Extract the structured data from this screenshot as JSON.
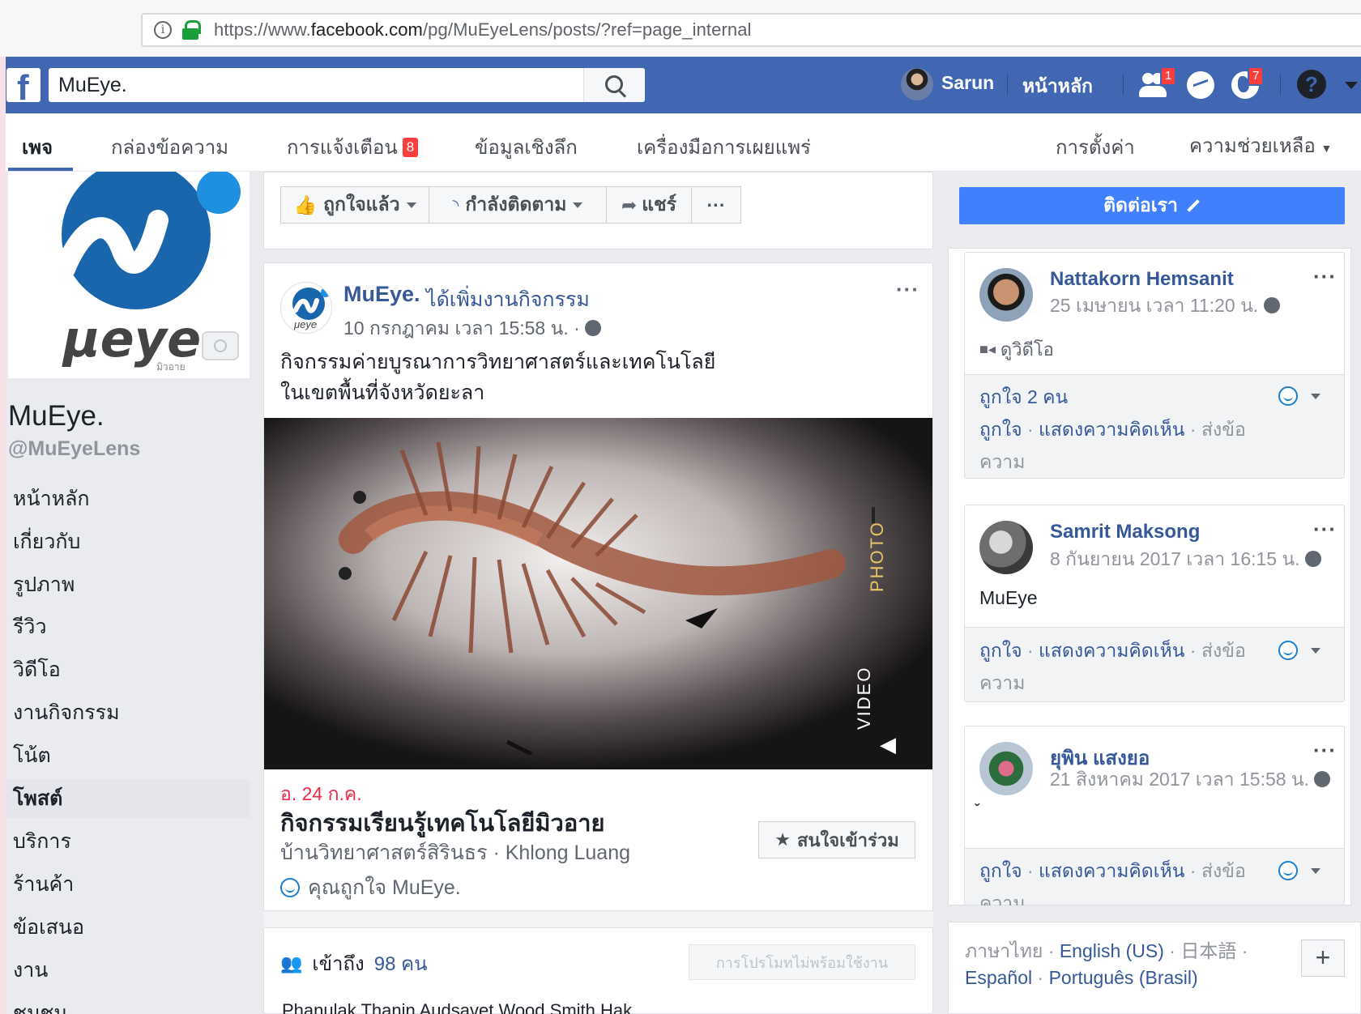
{
  "browser": {
    "url_prefix": "https://www.",
    "url_domain": "facebook.com",
    "url_path": "/pg/MuEyeLens/posts/?ref=page_internal"
  },
  "topbar": {
    "logo": "f",
    "search_value": "MuEye.",
    "user_name": "Sarun",
    "home_label": "หน้าหลัก",
    "friend_requests_badge": "1",
    "notifications_badge": "7",
    "help": "?"
  },
  "page_tabs": {
    "page": "เพจ",
    "inbox": "กล่องข้อความ",
    "notifications": "การแจ้งเตือน",
    "notifications_badge": "8",
    "insights": "ข้อมูลเชิงลึก",
    "publishing_tools": "เครื่องมือการเผยแพร่",
    "settings": "การตั้งค่า",
    "help": "ความช่วยเหลือ"
  },
  "page": {
    "name": "MuEye.",
    "handle": "@MuEyeLens",
    "logo_text": "μeye",
    "logo_sub": "มิวอาย"
  },
  "left_nav": [
    "หน้าหลัก",
    "เกี่ยวกับ",
    "รูปภาพ",
    "รีวิว",
    "วิดีโอ",
    "งานกิจกรรม",
    "โน้ต",
    "โพสต์",
    "บริการ",
    "ร้านค้า",
    "ข้อเสนอ",
    "งาน",
    "ชุมชน"
  ],
  "left_nav_selected": 7,
  "actions": {
    "liked": "ถูกใจแล้ว",
    "following": "กำลังติดตาม",
    "share": "แชร์",
    "more": "···"
  },
  "post": {
    "author": "MuEye.",
    "action": "ได้เพิ่มงานกิจกรรม",
    "time": "10 กรกฎาคม เวลา 15:58 น. ·",
    "text_line1": "กิจกรรมค่ายบูรณาการวิทยาศาสตร์และเทคโนโลยี",
    "text_line2": "ในเขตพื้นที่จังหวัดยะลา",
    "more": "···",
    "image_overlay_photo": "PHOTO",
    "image_overlay_video": "VIDEO",
    "avatar_text": "μeye"
  },
  "event": {
    "date": "อ. 24 ก.ค.",
    "title": "กิจกรรมเรียนรู้เทคโนโลยีมิวอาย",
    "place": "บ้านวิทยาศาสตร์สิรินธร · Khlong Luang",
    "liked": "คุณถูกใจ MuEye.",
    "interested_button": "สนใจเข้าร่วม"
  },
  "reach": {
    "prefix": "เข้าถึง",
    "count": "98 คน",
    "promo_button": "การโปรโมทไม่พร้อมใช้งาน",
    "footer_text": "Phanulak Thanin Audsavet Wood Smith Hak"
  },
  "contact_button": "ติดต่อเรา",
  "reviews": [
    {
      "name": "Nattakorn Hemsanit",
      "time": "25 เมษายน เวลา 11:20 น.",
      "content": "ดูวิดีโอ",
      "likes": "ถูกใจ 2 คน",
      "like": "ถูกใจ",
      "comment": "แสดงความคิดเห็น",
      "send": "ส่งข้อความ",
      "send_a": "ส่งข้อ",
      "send_b": "ความ",
      "more": "···"
    },
    {
      "name": "Samrit Maksong",
      "time": "8 กันยายน 2017 เวลา 16:15 น.",
      "content": "MuEye",
      "like": "ถูกใจ",
      "comment": "แสดงความคิดเห็น",
      "send_a": "ส่งข้อ",
      "send_b": "ความ",
      "more": "···"
    },
    {
      "name": "ยุพิน แสงยอ",
      "time": "21 สิงหาคม 2017 เวลา 15:58 น.",
      "content": "ˇ",
      "like": "ถูกใจ",
      "comment": "แสดงความคิดเห็น",
      "send_a": "ส่งข้อ",
      "send_b": "ความ",
      "more": "···"
    }
  ],
  "languages": {
    "thai": "ภาษาไทย",
    "english": "English (US)",
    "japanese": "日本語",
    "spanish": "Español",
    "portuguese": "Português (Brasil)",
    "plus": "+"
  },
  "colors": {
    "fb_blue": "#4267b2",
    "link_blue": "#365899",
    "contact_blue": "#4080ff",
    "badge_red": "#fa3e3e",
    "event_red": "#f02849",
    "gray_bg": "#e9ebee"
  }
}
